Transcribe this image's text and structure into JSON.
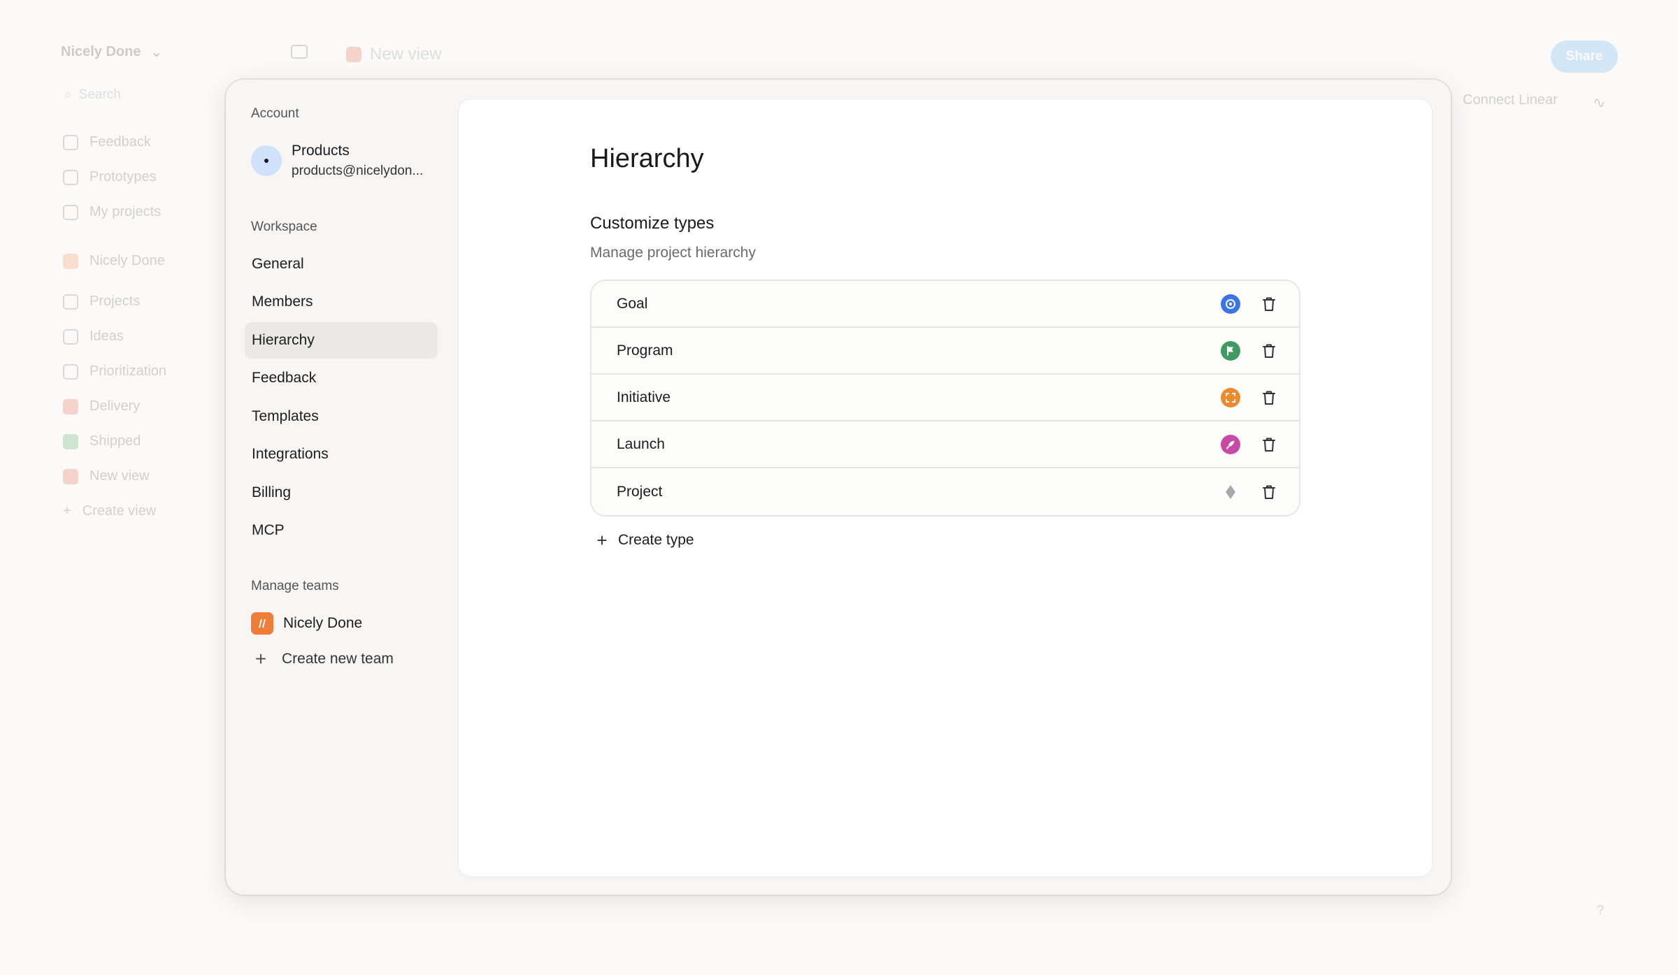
{
  "background": {
    "workspace_name": "Nicely Done",
    "search_placeholder": "Search",
    "nav": [
      {
        "label": "Feedback",
        "icon": "feedback-icon"
      },
      {
        "label": "Prototypes",
        "icon": "prototypes-icon"
      },
      {
        "label": "My projects",
        "icon": "user-icon"
      },
      {
        "label": "Nicely Done",
        "icon": "team-logo"
      },
      {
        "label": "Projects",
        "icon": "projects-icon"
      },
      {
        "label": "Ideas",
        "icon": "ideas-icon"
      },
      {
        "label": "Prioritization",
        "icon": "prioritization-icon"
      },
      {
        "label": "Delivery",
        "icon": "delivery-icon"
      },
      {
        "label": "Shipped",
        "icon": "shipped-icon"
      },
      {
        "label": "New view",
        "icon": "view-icon"
      },
      {
        "label": "Create view",
        "icon": "plus-icon"
      }
    ],
    "view_title": "New view",
    "share_label": "Share",
    "connect_label": "Connect Linear",
    "help_label": "?"
  },
  "settings_nav": {
    "account_title": "Account",
    "account": {
      "name": "Products",
      "email": "products@nicelydon..."
    },
    "workspace_title": "Workspace",
    "items": [
      {
        "label": "General"
      },
      {
        "label": "Members"
      },
      {
        "label": "Hierarchy"
      },
      {
        "label": "Feedback"
      },
      {
        "label": "Templates"
      },
      {
        "label": "Integrations"
      },
      {
        "label": "Billing"
      },
      {
        "label": "MCP"
      }
    ],
    "active_item": "Hierarchy",
    "teams_title": "Manage teams",
    "team_name": "Nicely Done",
    "create_team_label": "Create new team"
  },
  "content": {
    "title": "Hierarchy",
    "section_title": "Customize types",
    "section_subtitle": "Manage project hierarchy",
    "types": [
      {
        "name": "Goal",
        "icon": "target-icon",
        "color": "#3b74e6"
      },
      {
        "name": "Program",
        "icon": "flag-icon",
        "color": "#3f9a63"
      },
      {
        "name": "Initiative",
        "icon": "focus-icon",
        "color": "#ee8a2c"
      },
      {
        "name": "Launch",
        "icon": "rocket-icon",
        "color": "#c94aa6"
      },
      {
        "name": "Project",
        "icon": "diamond-icon",
        "color": "#a9a9a9"
      }
    ],
    "create_type_label": "Create type"
  }
}
